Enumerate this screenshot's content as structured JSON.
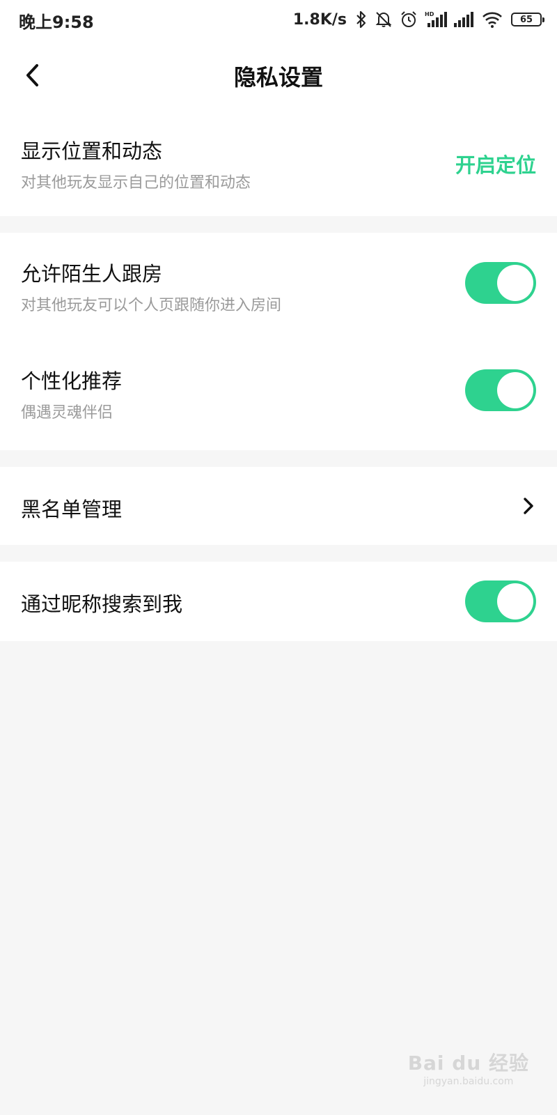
{
  "status_bar": {
    "time": "晚上9:58",
    "net_speed": "1.8K/s",
    "battery": "65",
    "icons": [
      "bluetooth-icon",
      "mute-icon",
      "alarm-icon",
      "hd-signal-icon",
      "signal-icon",
      "wifi-icon",
      "battery-icon"
    ]
  },
  "header": {
    "title": "隐私设置",
    "back_icon": "back-arrow-icon"
  },
  "settings": {
    "location": {
      "title": "显示位置和动态",
      "subtitle": "对其他玩友显示自己的位置和动态",
      "action_label": "开启定位"
    },
    "follow_room": {
      "title": "允许陌生人跟房",
      "subtitle": "对其他玩友可以个人页跟随你进入房间",
      "enabled": true
    },
    "personalized": {
      "title": "个性化推荐",
      "subtitle": "偶遇灵魂伴侣",
      "enabled": true
    },
    "blacklist": {
      "title": "黑名单管理"
    },
    "search_by_nickname": {
      "title": "通过昵称搜索到我",
      "enabled": true
    }
  },
  "colors": {
    "accent": "#2ed28f",
    "background": "#f6f6f6",
    "card": "#ffffff",
    "subtitle": "#9a9a9a"
  },
  "watermark": {
    "main": "Bai du 经验",
    "sub": "jingyan.baidu.com"
  }
}
